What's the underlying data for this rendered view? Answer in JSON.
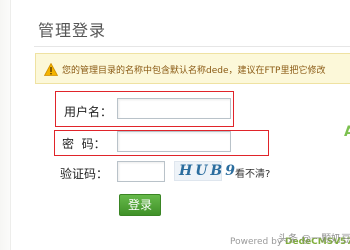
{
  "title": "管理登录",
  "warning": {
    "icon": "warning-icon",
    "text": "您的管理目录的名称中包含默认名称dede，建议在FTP里把它修改"
  },
  "form": {
    "username_label": "用户名：",
    "username_value": "",
    "password_label": "密  码：",
    "password_value": "",
    "captcha_label": "验证码：",
    "captcha_value": "",
    "captcha_image_text": "HUB9",
    "cant_see_text": "看不清?",
    "login_button": "登录"
  },
  "side_mark": "A",
  "footer": {
    "powered_by": "Powered by",
    "brand": "DedeCMSV57_"
  },
  "watermark": "头条 @一颗奶豆",
  "colors": {
    "warning_bg": "#fcf8d9",
    "button_green": "#4fa535",
    "highlight_red": "#e0242a"
  }
}
